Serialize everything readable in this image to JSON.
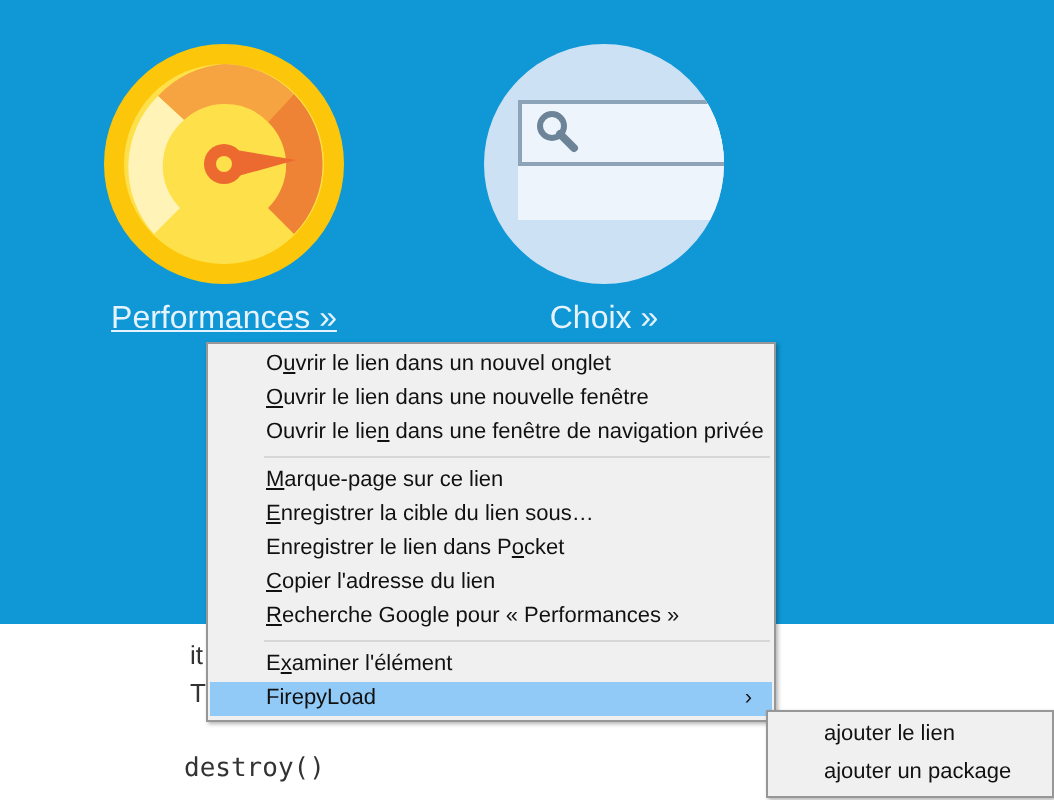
{
  "tiles": [
    {
      "kind": "gauge",
      "label": "Performances »",
      "underlined": true
    },
    {
      "kind": "search",
      "label": "Choix »",
      "underlined": false
    }
  ],
  "code_lines": [
    "it",
    "T",
    "destroy()"
  ],
  "context_menu": {
    "items": [
      {
        "kind": "item",
        "before": "O",
        "key": "u",
        "after": "vrir le lien dans un nouvel onglet",
        "selected": false
      },
      {
        "kind": "item",
        "key": "O",
        "after": "uvrir le lien dans une nouvelle fenêtre",
        "selected": false
      },
      {
        "kind": "item",
        "before": "Ouvrir le lie",
        "key": "n",
        "after": " dans une fenêtre de navigation privée",
        "selected": false
      },
      {
        "kind": "separator"
      },
      {
        "kind": "item",
        "key": "M",
        "after": "arque-page sur ce lien",
        "selected": false
      },
      {
        "kind": "item",
        "key": "E",
        "after": "nregistrer la cible du lien sous…",
        "selected": false
      },
      {
        "kind": "item",
        "before": "Enregistrer le lien dans P",
        "key": "o",
        "after": "cket",
        "selected": false
      },
      {
        "kind": "item",
        "key": "C",
        "after": "opier l'adresse du lien",
        "selected": false
      },
      {
        "kind": "item",
        "key": "R",
        "after": "echerche Google pour « Performances »",
        "selected": false
      },
      {
        "kind": "separator"
      },
      {
        "kind": "item",
        "before": "E",
        "key": "x",
        "after": "aminer l'élément",
        "selected": false
      },
      {
        "kind": "submenu",
        "before": "FirepyLoad",
        "arrow": "›",
        "selected": true
      }
    ]
  },
  "submenu": {
    "items": [
      {
        "label": "ajouter le lien"
      },
      {
        "label": "ajouter un package"
      }
    ]
  }
}
